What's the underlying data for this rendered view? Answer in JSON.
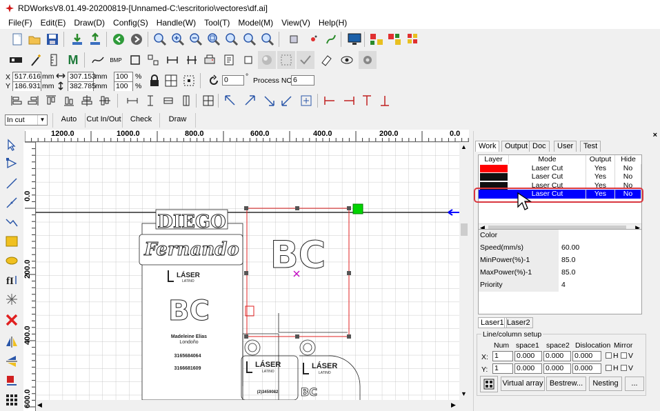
{
  "window": {
    "title": "RDWorksV8.01.49-20200819-[Unnamed-C:\\escritorio\\vectores\\df.ai]"
  },
  "menu": [
    "File(F)",
    "Edit(E)",
    "Draw(D)",
    "Config(S)",
    "Handle(W)",
    "Tool(T)",
    "Model(M)",
    "View(V)",
    "Help(H)"
  ],
  "position": {
    "x_label": "X",
    "y_label": "Y",
    "x_value": "517.616",
    "y_value": "186.931",
    "unit": "mm",
    "width_value": "307.153",
    "height_value": "382.785",
    "scale_x": "100",
    "scale_y": "100",
    "percent": "%",
    "rotate_value": "0",
    "degree": "°",
    "process_label": "Process NO:",
    "process_value": "6"
  },
  "cutbar": {
    "mode_select": "In cut",
    "auto": "Auto",
    "cut_in_out": "Cut In/Out",
    "check": "Check",
    "draw": "Draw"
  },
  "ruler": {
    "top": [
      "1200.0",
      "1000.0",
      "800.0",
      "600.0",
      "400.0",
      "200.0",
      "0.0"
    ],
    "left": [
      "0.0",
      "200.0",
      "400.0",
      "600.0"
    ]
  },
  "design": {
    "diego": "DIEGO",
    "fernando": "Fernando",
    "laser": "LÁSER",
    "latino": "LATINO",
    "bc": "BC",
    "name1": "Madeleine Elias",
    "name2": "Londoño",
    "phone1": "3165684064",
    "phone2": "3166681609",
    "code": "(2)3459082"
  },
  "panel": {
    "tabs": [
      "Work",
      "Output",
      "Doc",
      "User",
      "Test"
    ],
    "layer_headers": [
      "Layer",
      "Mode",
      "Output",
      "Hide"
    ],
    "layers": [
      {
        "color": "#ff0000",
        "mode": "Laser Cut",
        "output": "Yes",
        "hide": "No"
      },
      {
        "color": "#101010",
        "mode": "Laser Cut",
        "output": "Yes",
        "hide": "No"
      },
      {
        "color": "#101010",
        "mode": "Laser Cut",
        "output": "Yes",
        "hide": "No"
      },
      {
        "color": "#0000ff",
        "mode": "Laser Cut",
        "output": "Yes",
        "hide": "No"
      }
    ],
    "props": [
      {
        "k": "Color",
        "v": ""
      },
      {
        "k": "Speed(mm/s)",
        "v": "60.00"
      },
      {
        "k": "MinPower(%)-1",
        "v": "85.0"
      },
      {
        "k": "MaxPower(%)-1",
        "v": "85.0"
      },
      {
        "k": "Priority",
        "v": "4"
      }
    ],
    "prop_color": "#0000ff",
    "laser_tabs": [
      "Laser1",
      "Laser2"
    ],
    "linecol": {
      "title": "Line/column setup",
      "num": "Num",
      "space1": "space1",
      "space2": "space2",
      "dislocation": "Dislocation",
      "mirror": "Mirror",
      "x": "X:",
      "y": "Y:",
      "x_num": "1",
      "x_s1": "0.000",
      "x_s2": "0.000",
      "x_dis": "0.000",
      "y_num": "1",
      "y_s1": "0.000",
      "y_s2": "0.000",
      "y_dis": "0.000",
      "h": "H",
      "v": "V"
    },
    "buttons": {
      "virtual": "Virtual array",
      "bestrew": "Bestrew...",
      "nesting": "Nesting",
      "more": "..."
    }
  },
  "colors": {
    "accent_red": "#d9363e",
    "selected_blue": "#0000ff"
  }
}
